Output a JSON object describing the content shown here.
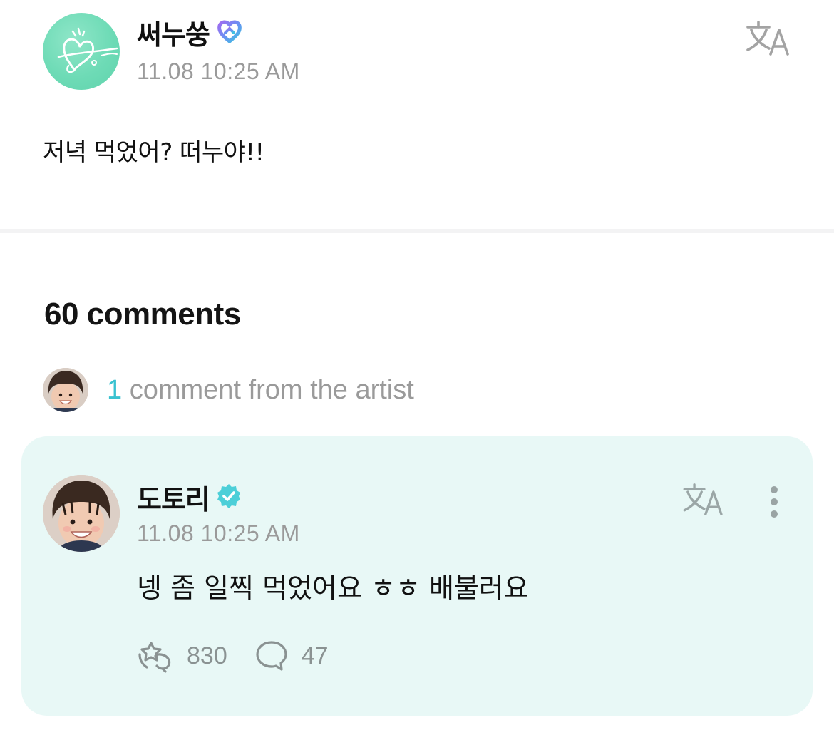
{
  "post": {
    "author": "써누쑹",
    "timestamp": "11.08 10:25 AM",
    "body": "저녁 먹었어? 떠누야!!",
    "author_badge_icon": "heart-badge-icon",
    "translate_icon": "translate-icon"
  },
  "comments": {
    "count_label": "60 comments",
    "artist_summary": {
      "count": "1",
      "text": " comment from the artist"
    }
  },
  "artist_comment": {
    "author": "도토리",
    "verified_icon": "verified-badge-icon",
    "timestamp": "11.08 10:25 AM",
    "body": "넹 좀 일찍 먹었어요 ㅎㅎ 배불러요",
    "likes": "830",
    "replies": "47",
    "like_icon": "like-icon",
    "reply_icon": "reply-icon",
    "more_icon": "more-vertical-icon"
  },
  "colors": {
    "accent": "#39c2d0",
    "card_background": "#e8f8f6",
    "muted_text": "#9a9a9a",
    "avatar_green": "#6edbb6"
  }
}
